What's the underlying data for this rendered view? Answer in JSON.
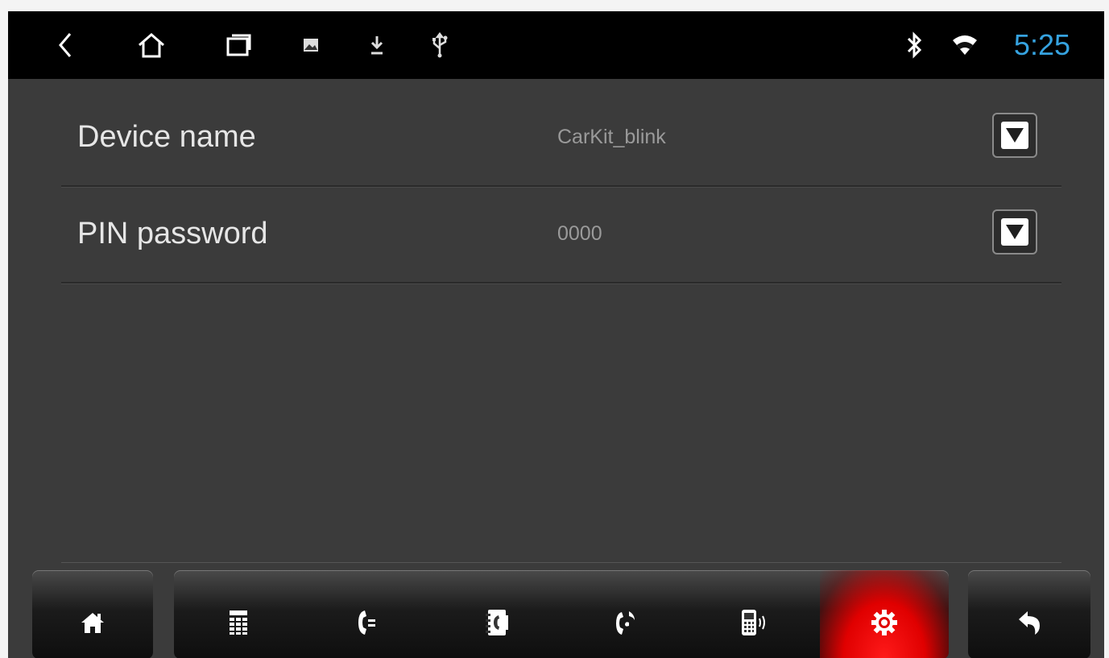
{
  "status_bar": {
    "time": "5:25",
    "left_icons": [
      "back-icon",
      "home-icon",
      "recent-apps-icon",
      "image-icon",
      "download-icon",
      "usb-icon"
    ],
    "right_icons": [
      "bluetooth-icon",
      "wifi-icon"
    ],
    "time_color": "#36a3e0"
  },
  "settings": {
    "rows": [
      {
        "label": "Device name",
        "value": "CarKit_blink"
      },
      {
        "label": "PIN password",
        "value": "0000"
      }
    ]
  },
  "bottom_bar": {
    "left_button": "home-icon",
    "tabs": [
      "dialpad-icon",
      "call-log-icon",
      "contacts-icon",
      "music-icon",
      "phone-link-icon",
      "settings-icon"
    ],
    "active_tab": "settings-icon",
    "active_color": "#ff0000",
    "right_button": "return-icon"
  }
}
